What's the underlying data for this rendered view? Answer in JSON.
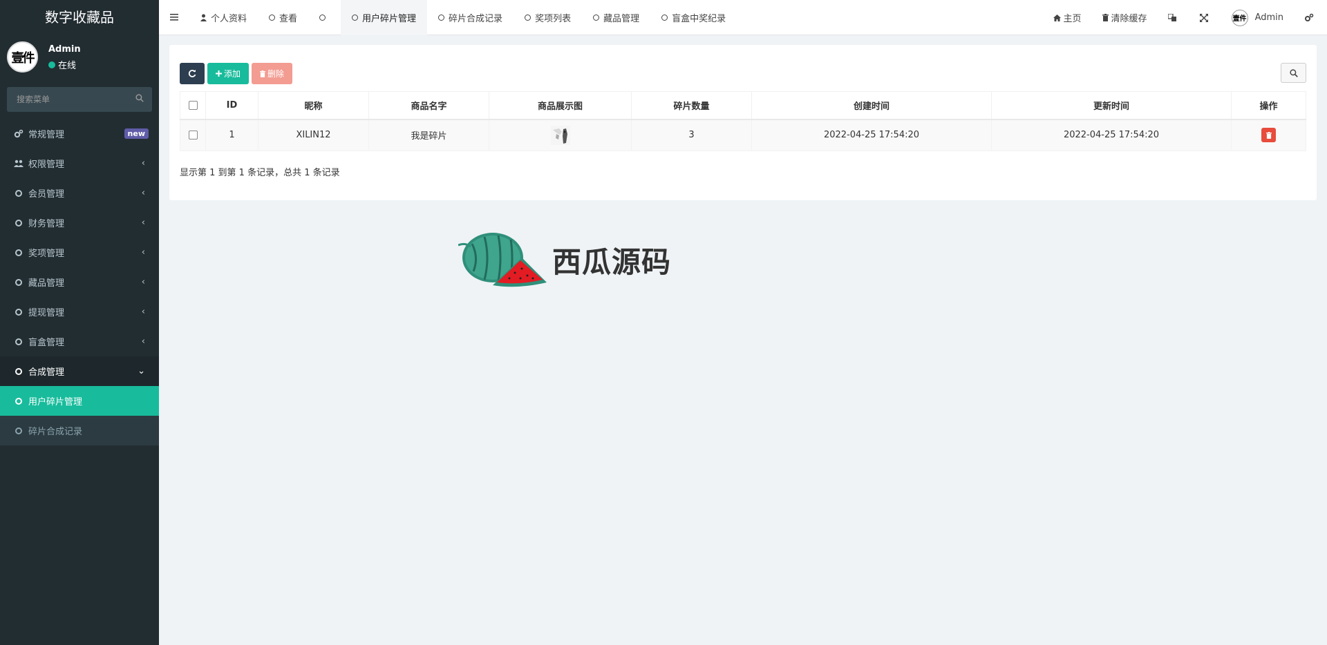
{
  "app": {
    "title": "数字收藏品",
    "user": {
      "name": "Admin",
      "status": "在线",
      "avatar_text": "壹件"
    }
  },
  "sidebar": {
    "search_placeholder": "搜索菜单",
    "items": [
      {
        "label": "常规管理",
        "icon": "cogs-icon",
        "badge": "new"
      },
      {
        "label": "权限管理",
        "icon": "users-icon",
        "arrow": "‹"
      },
      {
        "label": "会员管理",
        "icon": "circle-o-icon",
        "arrow": "‹"
      },
      {
        "label": "财务管理",
        "icon": "circle-o-icon",
        "arrow": "‹"
      },
      {
        "label": "奖项管理",
        "icon": "circle-o-icon",
        "arrow": "‹"
      },
      {
        "label": "藏品管理",
        "icon": "circle-o-icon",
        "arrow": "‹"
      },
      {
        "label": "提现管理",
        "icon": "circle-o-icon",
        "arrow": "‹"
      },
      {
        "label": "盲盒管理",
        "icon": "circle-o-icon",
        "arrow": "‹"
      },
      {
        "label": "合成管理",
        "icon": "circle-o-icon",
        "arrow": "⌄"
      },
      {
        "label": "用户碎片管理",
        "icon": "circle-o-icon"
      },
      {
        "label": "碎片合成记录",
        "icon": "circle-o-icon"
      }
    ]
  },
  "header": {
    "tabs": [
      {
        "label": "个人资料",
        "icon": "user-icon"
      },
      {
        "label": "查看",
        "icon": "circle-o-icon"
      },
      {
        "label": "",
        "icon": "circle-o-icon"
      },
      {
        "label": "用户碎片管理",
        "icon": "circle-o-icon",
        "active": true
      },
      {
        "label": "碎片合成记录",
        "icon": "circle-o-icon"
      },
      {
        "label": "奖项列表",
        "icon": "circle-o-icon"
      },
      {
        "label": "藏品管理",
        "icon": "circle-o-icon"
      },
      {
        "label": "盲盒中奖纪录",
        "icon": "circle-o-icon"
      }
    ],
    "right": {
      "home": "主页",
      "clear_cache": "清除缓存",
      "user": "Admin"
    }
  },
  "toolbar": {
    "add": "添加",
    "delete": "删除"
  },
  "table": {
    "columns": [
      "ID",
      "昵称",
      "商品名字",
      "商品展示图",
      "碎片数量",
      "创建时间",
      "更新时间",
      "操作"
    ],
    "rows": [
      {
        "id": "1",
        "nickname": "XILIN12",
        "goods_name": "我是碎片",
        "count": "3",
        "created": "2022-04-25 17:54:20",
        "updated": "2022-04-25 17:54:20"
      }
    ]
  },
  "pager_info": "显示第 1 到第 1 条记录，总共 1 条记录",
  "watermark": {
    "text": "西瓜源码"
  },
  "colors": {
    "sidebar_bg": "#222d32",
    "accent": "#18bc9c",
    "danger": "#e74c3c",
    "badge": "#605ca8"
  }
}
